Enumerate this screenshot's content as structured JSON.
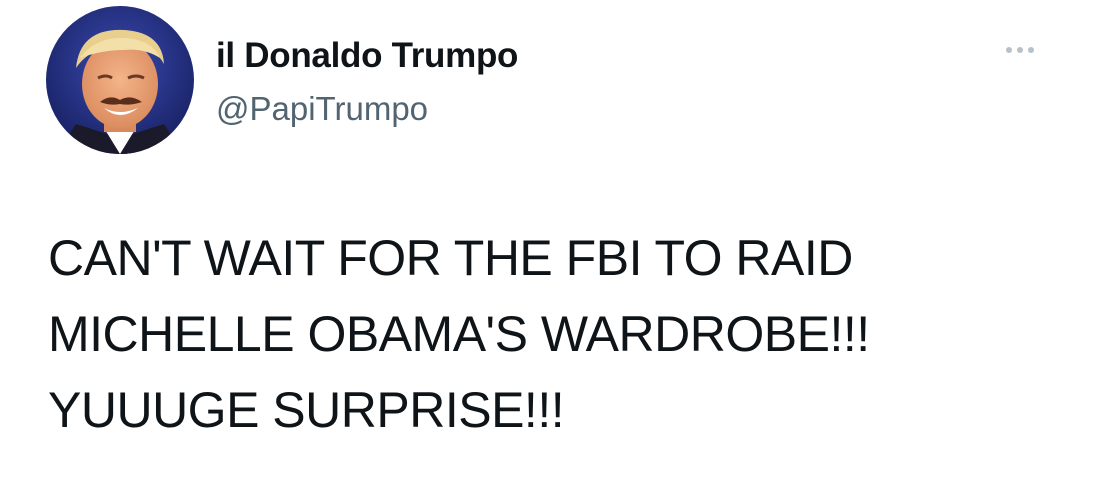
{
  "author": {
    "display_name": "il Donaldo Trumpo",
    "handle": "@PapiTrumpo",
    "avatar_icon": "profile-photo-avatar"
  },
  "menu": {
    "icon": "more-options-icon"
  },
  "tweet": {
    "lines": [
      "CAN'T WAIT FOR THE FBI TO RAID",
      "MICHELLE OBAMA'S WARDROBE!!!",
      "YUUUGE SURPRISE!!!"
    ]
  },
  "colors": {
    "text_primary": "#0f1419",
    "text_secondary": "#536471",
    "background": "#ffffff",
    "avatar_bg": "#1e2a7a"
  }
}
